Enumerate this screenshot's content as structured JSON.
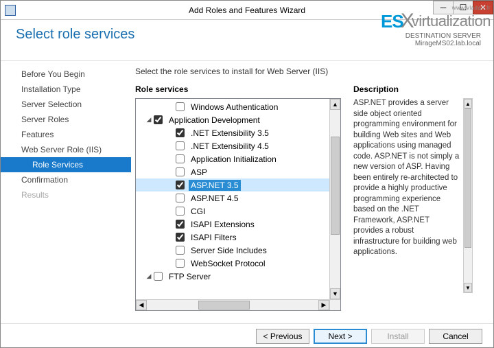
{
  "window": {
    "title": "Add Roles and Features Wizard"
  },
  "watermark": {
    "url": "www.vladan.fr",
    "part1": "ES",
    "part2": "X",
    "part3": "virtualization"
  },
  "header": {
    "page_title": "Select role services",
    "destination_label": "DESTINATION SERVER",
    "destination_value": "MirageMS02.lab.local"
  },
  "nav": {
    "items": [
      {
        "label": "Before You Begin",
        "selected": false,
        "sub": false,
        "disabled": false
      },
      {
        "label": "Installation Type",
        "selected": false,
        "sub": false,
        "disabled": false
      },
      {
        "label": "Server Selection",
        "selected": false,
        "sub": false,
        "disabled": false
      },
      {
        "label": "Server Roles",
        "selected": false,
        "sub": false,
        "disabled": false
      },
      {
        "label": "Features",
        "selected": false,
        "sub": false,
        "disabled": false
      },
      {
        "label": "Web Server Role (IIS)",
        "selected": false,
        "sub": false,
        "disabled": false
      },
      {
        "label": "Role Services",
        "selected": true,
        "sub": true,
        "disabled": false
      },
      {
        "label": "Confirmation",
        "selected": false,
        "sub": false,
        "disabled": false
      },
      {
        "label": "Results",
        "selected": false,
        "sub": false,
        "disabled": true
      }
    ]
  },
  "main": {
    "instruction": "Select the role services to install for Web Server (IIS)",
    "roles_heading": "Role services",
    "desc_heading": "Description",
    "description": "ASP.NET provides a server side object oriented programming environment for building Web sites and Web applications using managed code. ASP.NET is not simply a new version of ASP. Having been entirely re-architected to provide a highly productive programming experience based on the .NET Framework, ASP.NET provides a robust infrastructure for building web applications.",
    "tree": [
      {
        "level": 2,
        "label": "Windows Authentication",
        "checked": false,
        "twisty": "",
        "selected": false
      },
      {
        "level": 1,
        "label": "Application Development",
        "checked": true,
        "twisty": "open",
        "selected": false
      },
      {
        "level": 2,
        "label": ".NET Extensibility 3.5",
        "checked": true,
        "twisty": "",
        "selected": false
      },
      {
        "level": 2,
        "label": ".NET Extensibility 4.5",
        "checked": false,
        "twisty": "",
        "selected": false
      },
      {
        "level": 2,
        "label": "Application Initialization",
        "checked": false,
        "twisty": "",
        "selected": false
      },
      {
        "level": 2,
        "label": "ASP",
        "checked": false,
        "twisty": "",
        "selected": false
      },
      {
        "level": 2,
        "label": "ASP.NET 3.5",
        "checked": true,
        "twisty": "",
        "selected": true
      },
      {
        "level": 2,
        "label": "ASP.NET 4.5",
        "checked": false,
        "twisty": "",
        "selected": false
      },
      {
        "level": 2,
        "label": "CGI",
        "checked": false,
        "twisty": "",
        "selected": false
      },
      {
        "level": 2,
        "label": "ISAPI Extensions",
        "checked": true,
        "twisty": "",
        "selected": false
      },
      {
        "level": 2,
        "label": "ISAPI Filters",
        "checked": true,
        "twisty": "",
        "selected": false
      },
      {
        "level": 2,
        "label": "Server Side Includes",
        "checked": false,
        "twisty": "",
        "selected": false
      },
      {
        "level": 2,
        "label": "WebSocket Protocol",
        "checked": false,
        "twisty": "",
        "selected": false
      },
      {
        "level": 1,
        "label": "FTP Server",
        "checked": false,
        "twisty": "open",
        "selected": false
      }
    ]
  },
  "footer": {
    "previous": "< Previous",
    "next": "Next >",
    "install": "Install",
    "cancel": "Cancel"
  }
}
